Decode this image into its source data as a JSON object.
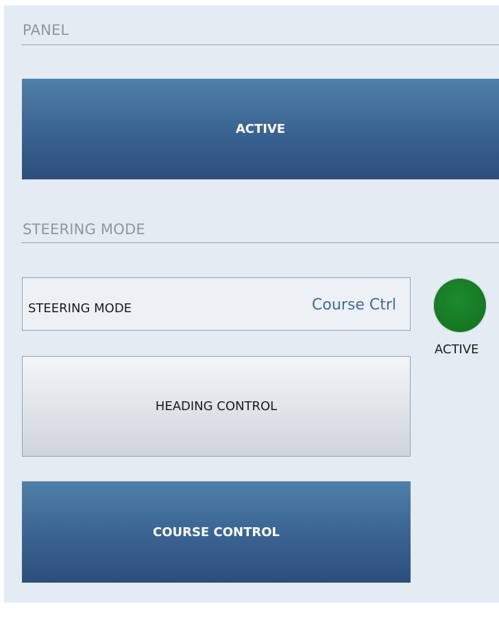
{
  "panel_section": {
    "title": "PANEL",
    "active_button_label": "ACTIVE"
  },
  "steering_section": {
    "title": "STEERING MODE",
    "mode_display": {
      "label": "STEERING MODE",
      "value": "Course Ctrl"
    },
    "indicator": {
      "label": "ACTIVE",
      "color": "#177a24"
    },
    "heading_control_label": "HEADING CONTROL",
    "course_control_label": "COURSE CONTROL"
  },
  "colors": {
    "background": "#e4ebf2",
    "active_button": "#3d6795",
    "value_text": "#3f6a96",
    "section_title": "#8f979f"
  }
}
